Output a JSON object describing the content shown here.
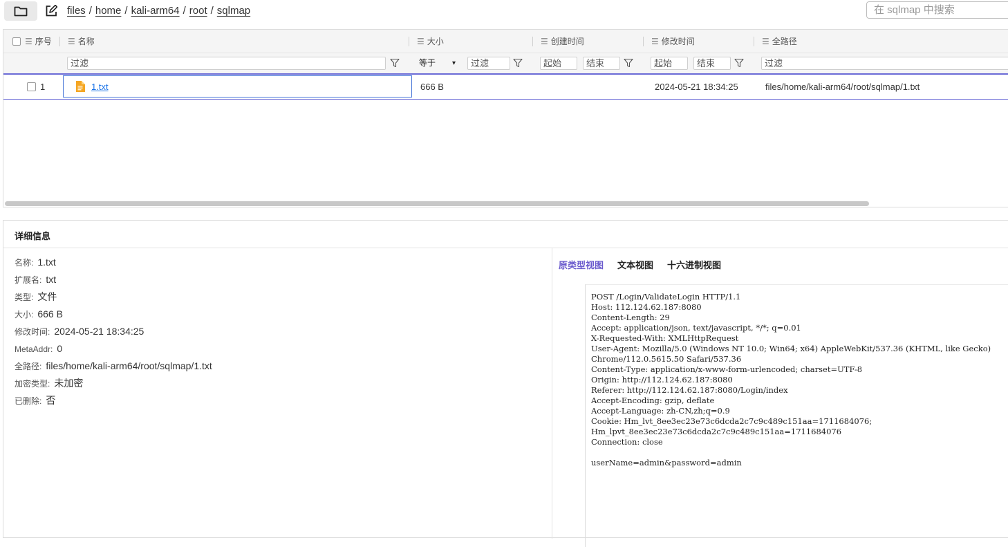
{
  "topbar": {
    "folder_icon": "folder-icon",
    "edit_icon": "edit-icon",
    "breadcrumb": [
      "files",
      "home",
      "kali-arm64",
      "root",
      "sqlmap"
    ],
    "separator": "/",
    "search_placeholder": "在 sqlmap 中搜索"
  },
  "table": {
    "columns": {
      "index": "序号",
      "name": "名称",
      "size": "大小",
      "created": "创建时间",
      "modified": "修改时间",
      "path": "全路径"
    },
    "filters": {
      "name_filter": "过滤",
      "size_op": "等于",
      "size_op_arrow": "▾",
      "size_filter": "过滤",
      "created_start": "起始",
      "created_end": "结束",
      "modified_start": "起始",
      "modified_end": "结束",
      "path_filter": "过滤"
    },
    "rows": [
      {
        "index": "1",
        "name": "1.txt",
        "size": "666 B",
        "created": "",
        "modified": "2024-05-21 18:34:25",
        "path": "files/home/kali-arm64/root/sqlmap/1.txt",
        "icon": "text-file-icon"
      }
    ]
  },
  "details": {
    "title": "详细信息",
    "props": [
      {
        "k": "名称:",
        "v": "1.txt"
      },
      {
        "k": "扩展名:",
        "v": "txt"
      },
      {
        "k": "类型:",
        "v": "文件"
      },
      {
        "k": "大小:",
        "v": "666 B"
      },
      {
        "k": "修改时间:",
        "v": "2024-05-21 18:34:25"
      },
      {
        "k": "MetaAddr:",
        "v": "0"
      },
      {
        "k": "全路径:",
        "v": "files/home/kali-arm64/root/sqlmap/1.txt"
      },
      {
        "k": "加密类型:",
        "v": "未加密"
      },
      {
        "k": "已删除:",
        "v": "否"
      }
    ],
    "tabs": [
      "原类型视图",
      "文本视图",
      "十六进制视图"
    ],
    "active_tab": "原类型视图",
    "content": "POST /Login/ValidateLogin HTTP/1.1\nHost: 112.124.62.187:8080\nContent-Length: 29\nAccept: application/json, text/javascript, */*; q=0.01\nX-Requested-With: XMLHttpRequest\nUser-Agent: Mozilla/5.0 (Windows NT 10.0; Win64; x64) AppleWebKit/537.36 (KHTML, like Gecko)\nChrome/112.0.5615.50 Safari/537.36\nContent-Type: application/x-www-form-urlencoded; charset=UTF-8\nOrigin: http://112.124.62.187:8080\nReferer: http://112.124.62.187:8080/Login/index\nAccept-Encoding: gzip, deflate\nAccept-Language: zh-CN,zh;q=0.9\nCookie: Hm_lvt_8ee3ec23e73c6dcda2c7c9c489c151aa=1711684076;\nHm_lpvt_8ee3ec23e73c6dcda2c7c9c489c151aa=1711684076\nConnection: close\n\nuserName=admin&password=admin"
  },
  "colors": {
    "accent": "#6a5acd",
    "link": "#1a73e8",
    "selection_border": "#4a78d8",
    "file_icon": "#f5a623"
  }
}
